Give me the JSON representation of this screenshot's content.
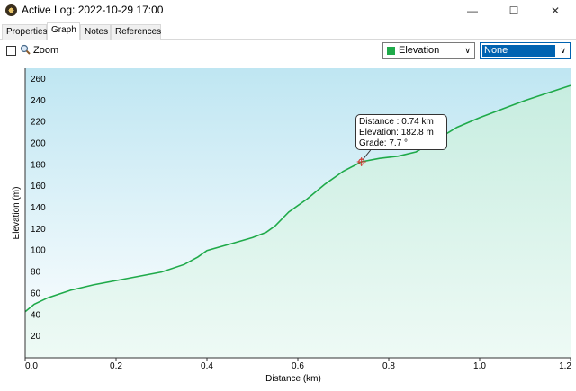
{
  "window": {
    "title": "Active Log: 2022-10-29 17:00"
  },
  "tabs": [
    {
      "label": "Properties"
    },
    {
      "label": "Graph"
    },
    {
      "label": "Notes"
    },
    {
      "label": "References"
    }
  ],
  "toolbar": {
    "zoom_label": "Zoom",
    "zoom_checked": false,
    "primary_select": {
      "value": "Elevation",
      "color": "#1faa4a"
    },
    "secondary_select": {
      "value": "None"
    }
  },
  "tooltip": {
    "distance": "Distance : 0.74 km",
    "elevation": "Elevation: 182.8 m",
    "grade": "Grade: 7.7 °"
  },
  "chart_data": {
    "type": "area",
    "xlabel": "Distance  (km)",
    "ylabel": "Elevation (m)",
    "xlim": [
      0,
      1.2
    ],
    "ylim": [
      0,
      270
    ],
    "x_ticks": [
      0.0,
      0.2,
      0.4,
      0.6,
      0.8,
      1.0,
      1.2
    ],
    "x_tick_labels": [
      "0.0",
      "0.2",
      "0.4",
      "0.6",
      "0.8",
      "1.0",
      "1.2"
    ],
    "y_ticks": [
      20,
      40,
      60,
      80,
      100,
      120,
      140,
      160,
      180,
      200,
      220,
      240,
      260
    ],
    "y_tick_labels": [
      "20",
      "40",
      "60",
      "80",
      "100",
      "120",
      "140",
      "160",
      "180",
      "200",
      "220",
      "240",
      "260"
    ],
    "series": [
      {
        "color": "#1faa4a",
        "x": [
          0.0,
          0.02,
          0.05,
          0.1,
          0.15,
          0.2,
          0.25,
          0.3,
          0.35,
          0.38,
          0.4,
          0.45,
          0.5,
          0.53,
          0.55,
          0.58,
          0.62,
          0.66,
          0.7,
          0.74,
          0.78,
          0.82,
          0.86,
          0.9,
          0.95,
          1.0,
          1.05,
          1.1,
          1.15,
          1.2
        ],
        "y": [
          43,
          50,
          56,
          63,
          68,
          72,
          76,
          80,
          87,
          94,
          100,
          106,
          112,
          117,
          123,
          136,
          148,
          162,
          174,
          182.8,
          186,
          188,
          192,
          202,
          215,
          224,
          232,
          240,
          247,
          254
        ]
      }
    ],
    "marker": {
      "x": 0.74,
      "y": 182.8
    },
    "grid": false
  }
}
